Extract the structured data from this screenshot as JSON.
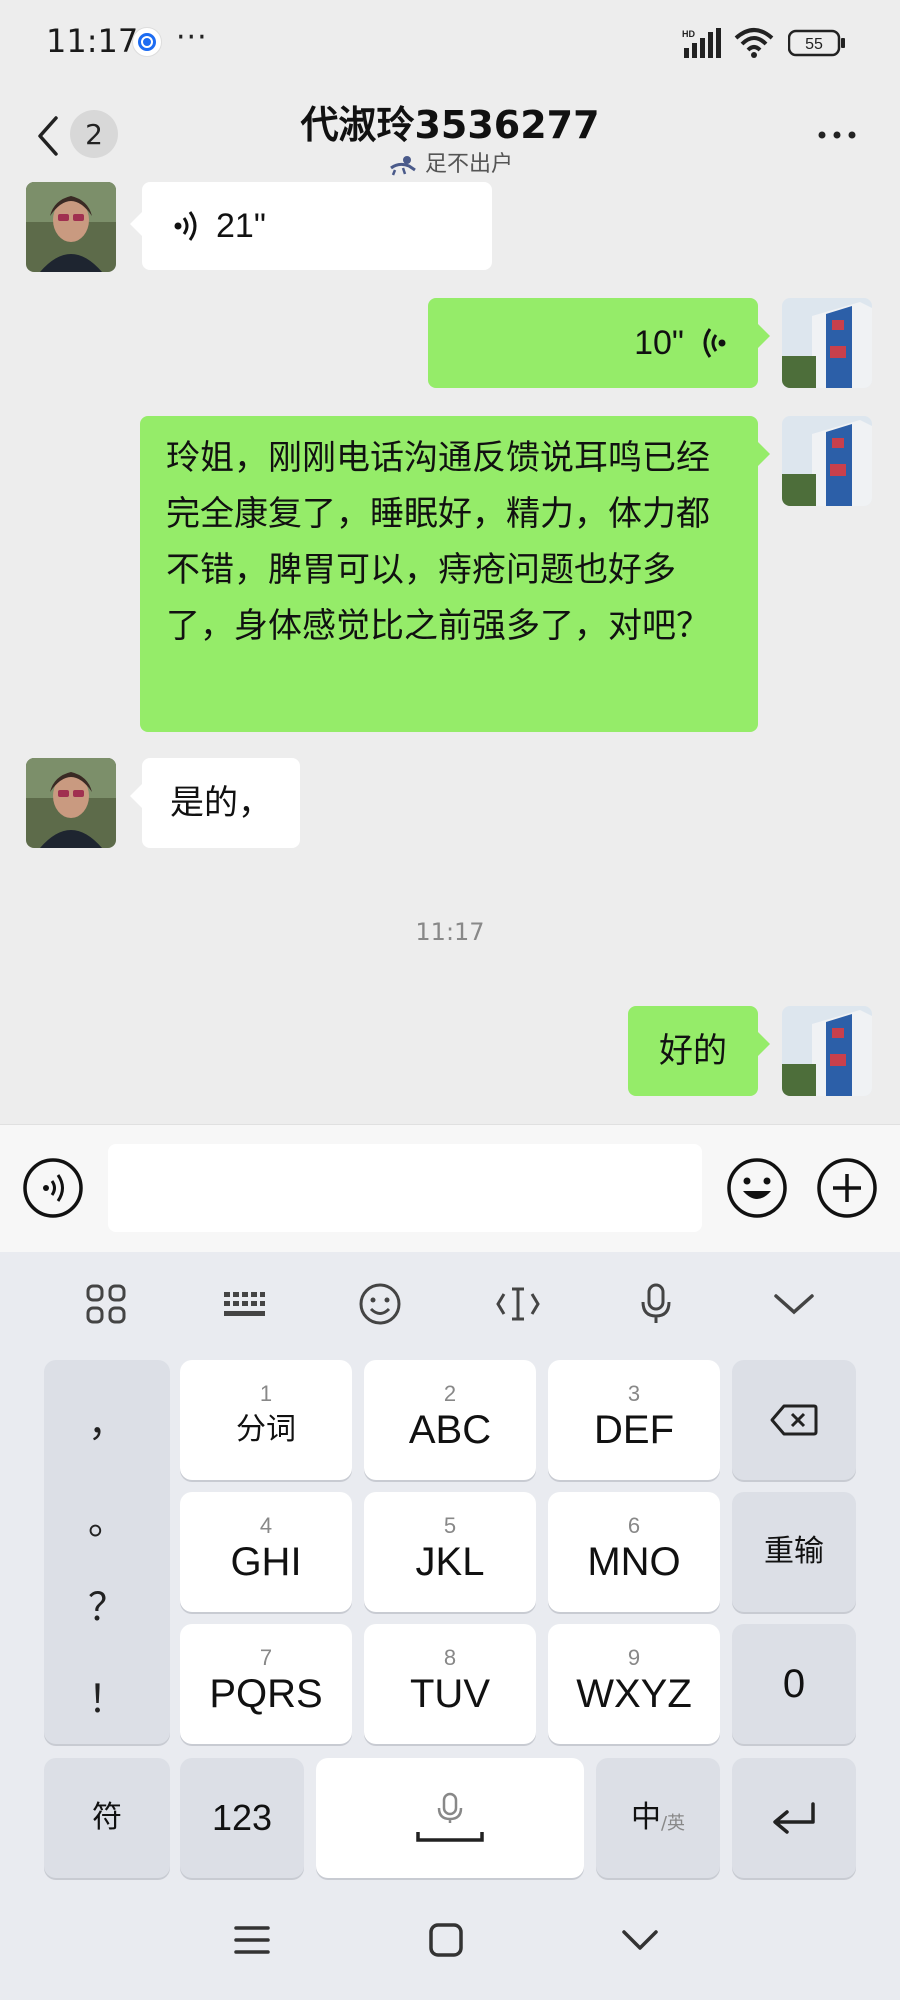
{
  "status_bar": {
    "time": "11:17",
    "more": "···",
    "network": "HD",
    "battery": "55"
  },
  "header": {
    "unread_count": "2",
    "title": "代淑玲3536277",
    "subtitle": "足不出户"
  },
  "messages": [
    {
      "side": "left",
      "type": "voice",
      "duration": "21\""
    },
    {
      "side": "right",
      "type": "voice",
      "duration": "10\""
    },
    {
      "side": "right",
      "type": "text",
      "text": "玲姐，刚刚电话沟通反馈说耳鸣已经完全康复了，睡眠好，精力，体力都不错，脾胃可以，痔疮问题也好多了，身体感觉比之前强多了，对吧？"
    },
    {
      "side": "left",
      "type": "text",
      "text": "是的，"
    },
    {
      "side": "right",
      "type": "text",
      "text": "好的"
    }
  ],
  "timestamp": "11:17",
  "input": {
    "value": "",
    "placeholder": ""
  },
  "keyboard": {
    "punctuation": [
      "，",
      "。",
      "？",
      "！"
    ],
    "keys": [
      {
        "num": "1",
        "label": "分词"
      },
      {
        "num": "2",
        "label": "ABC"
      },
      {
        "num": "3",
        "label": "DEF"
      },
      {
        "num": "4",
        "label": "GHI"
      },
      {
        "num": "5",
        "label": "JKL"
      },
      {
        "num": "6",
        "label": "MNO"
      },
      {
        "num": "7",
        "label": "PQRS"
      },
      {
        "num": "8",
        "label": "TUV"
      },
      {
        "num": "9",
        "label": "WXYZ"
      }
    ],
    "reinput": "重输",
    "zero": "0",
    "symbols": "符",
    "numbers": "123",
    "lang_main": "中",
    "lang_alt": "/英"
  },
  "colors": {
    "bubble_right": "#95ec69",
    "bubble_left": "#ffffff",
    "background": "#ededed",
    "keyboard": "#e9ebf0"
  }
}
